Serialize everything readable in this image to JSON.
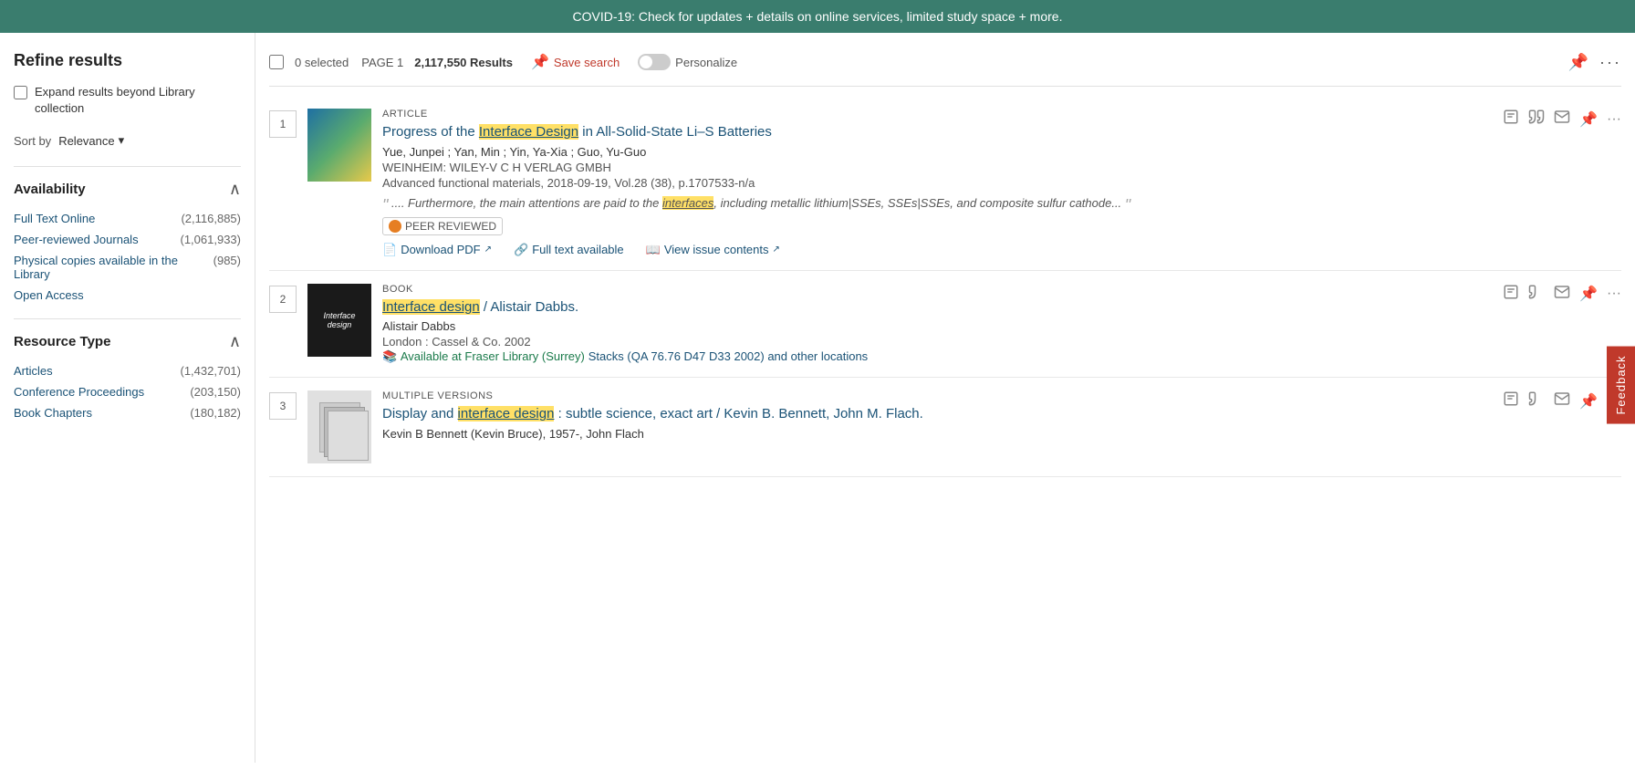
{
  "banner": {
    "text": "COVID-19: Check for updates + details on online services, limited study space + more."
  },
  "sidebar": {
    "title": "Refine results",
    "expand_option": {
      "label": "Expand results beyond Library collection",
      "checked": false
    },
    "sort_by": {
      "label": "Sort by",
      "value": "Relevance"
    },
    "availability": {
      "title": "Availability",
      "expanded": true,
      "items": [
        {
          "label": "Full Text Online",
          "count": "(2,116,885)"
        },
        {
          "label": "Peer-reviewed Journals",
          "count": "(1,061,933)"
        },
        {
          "label": "Physical copies available in the Library",
          "count": "(985)"
        },
        {
          "label": "Open Access",
          "count": ""
        }
      ]
    },
    "resource_type": {
      "title": "Resource Type",
      "expanded": true,
      "items": [
        {
          "label": "Articles",
          "count": "(1,432,701)"
        },
        {
          "label": "Conference Proceedings",
          "count": "(203,150)"
        },
        {
          "label": "Book Chapters",
          "count": "(180,182)"
        }
      ]
    }
  },
  "toolbar": {
    "selected_count": "0 selected",
    "page_label": "PAGE 1",
    "results_count": "2,117,550 Results",
    "save_search": "Save search",
    "personalize": "Personalize"
  },
  "results": [
    {
      "number": "1",
      "type": "ARTICLE",
      "title": "Progress of the Interface Design in All-Solid-State Li–S Batteries",
      "title_highlight_word": "interfaces",
      "authors": "Yue, Junpei ; Yan, Min ; Yin, Ya-Xia ; Guo, Yu-Guo",
      "publisher": "WEINHEIM: WILEY-V C H VERLAG GMBH",
      "journal": "Advanced functional materials, 2018-09-19, Vol.28 (38), p.1707533-n/a",
      "snippet": ".... Furthermore, the main attentions are paid to the interfaces, including metallic lithium|SSEs, SSEs|SSEs, and composite sulfur cathode...",
      "peer_reviewed": true,
      "peer_reviewed_label": "PEER REVIEWED",
      "actions": [
        {
          "label": "Download PDF",
          "icon": "pdf"
        },
        {
          "label": "Full text available",
          "icon": "link"
        },
        {
          "label": "View issue contents",
          "icon": "book"
        }
      ],
      "thumbnail_type": "article"
    },
    {
      "number": "2",
      "type": "BOOK",
      "title": "Interface design / Alistair Dabbs.",
      "title_highlight_word": "Interface design",
      "authors": "Alistair Dabbs",
      "publisher": "London : Cassel & Co. 2002",
      "availability": "Available at Fraser Library (Surrey)",
      "location": "Stacks (QA 76.76 D47 D33 2002) and other locations",
      "thumbnail_type": "book"
    },
    {
      "number": "3",
      "type": "MULTIPLE VERSIONS",
      "title": "Display and interface design : subtle science, exact art / Kevin B. Bennett, John M. Flach.",
      "title_highlight_word": "interface design",
      "authors": "Kevin B Bennett (Kevin Bruce), 1957-, John Flach",
      "thumbnail_type": "multiple"
    }
  ]
}
